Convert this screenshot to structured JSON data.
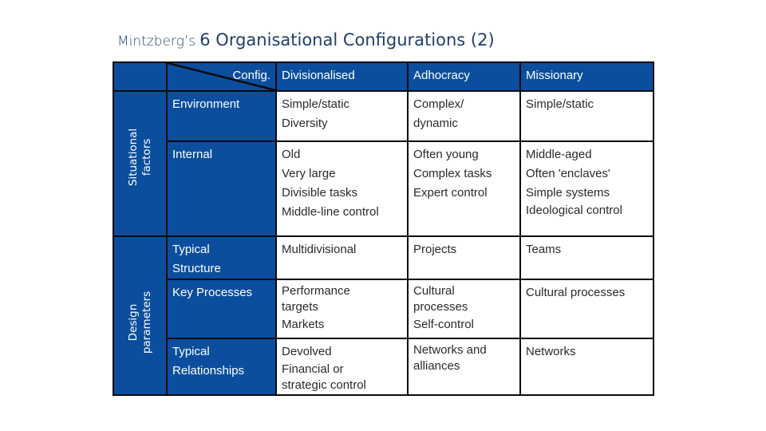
{
  "title": {
    "prefix": "Mintzberg’s",
    "main": "6 Organisational Configurations (2)"
  },
  "table": {
    "corner_label": "Config.",
    "columns": [
      "Divisionalised",
      "Adhocracy",
      "Missionary"
    ],
    "groups": [
      {
        "label_line1": "Situational",
        "label_line2": "factors"
      },
      {
        "label_line1": "Design",
        "label_line2": "parameters"
      }
    ],
    "rows": [
      {
        "label": "Environment",
        "cells": [
          [
            "Simple/static",
            "Diversity"
          ],
          [
            "Complex/",
            "dynamic"
          ],
          [
            "Simple/static"
          ]
        ]
      },
      {
        "label": "Internal",
        "cells": [
          [
            "Old",
            "Very large",
            "Divisible tasks",
            "Middle-line control"
          ],
          [
            "Often young",
            "Complex tasks",
            "Expert control"
          ],
          [
            "Middle-aged",
            "Often 'enclaves'",
            "Simple systems",
            "Ideological control"
          ]
        ]
      },
      {
        "label_line1": "Typical",
        "label_line2": "Structure",
        "cells": [
          [
            "Multidivisional"
          ],
          [
            "Projects"
          ],
          [
            "Teams"
          ]
        ]
      },
      {
        "label": "Key Processes",
        "cells": [
          [
            "Performance",
            "targets",
            "Markets"
          ],
          [
            "Cultural",
            "processes",
            "Self-control"
          ],
          [
            "Cultural processes"
          ]
        ]
      },
      {
        "label_line1": "Typical",
        "label_line2": "Relationships",
        "cells": [
          [
            "Devolved",
            "Financial or",
            "strategic control"
          ],
          [
            "Networks and",
            "alliances"
          ],
          [
            "Networks"
          ]
        ]
      }
    ]
  },
  "colors": {
    "header_blue": "#0b4e9e",
    "border": "#0b0b0b",
    "title": "#1f3f6b"
  }
}
